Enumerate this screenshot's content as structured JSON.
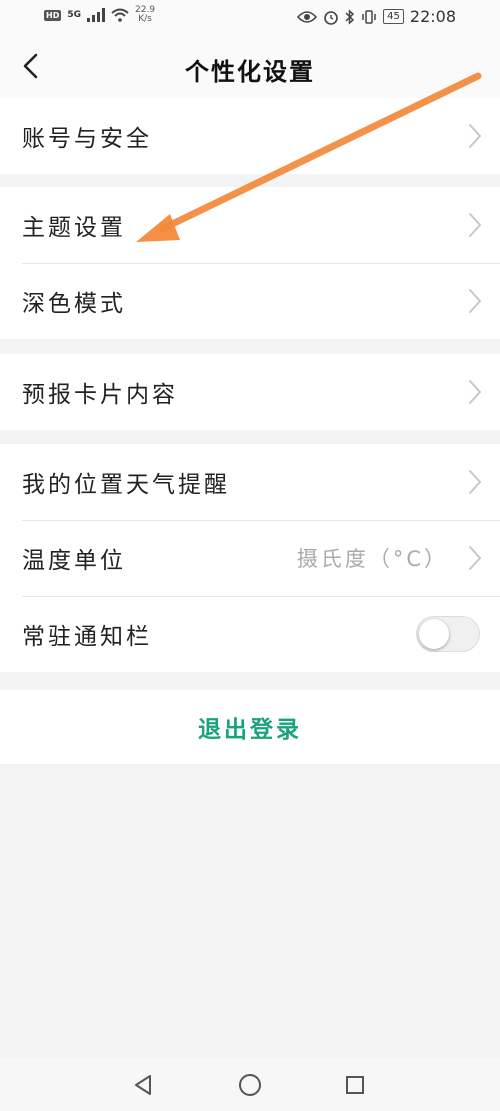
{
  "status_bar": {
    "hd": "HD",
    "network": "5G",
    "speed_value": "22.9",
    "speed_unit": "K/s",
    "battery": "45",
    "time": "22:08"
  },
  "header": {
    "title": "个性化设置",
    "back_icon": "chevron-left-icon"
  },
  "groups": {
    "account": {
      "label": "账号与安全"
    },
    "theme": {
      "label": "主题设置"
    },
    "dark_mode": {
      "label": "深色模式"
    },
    "forecast_card": {
      "label": "预报卡片内容"
    },
    "location_alert": {
      "label": "我的位置天气提醒"
    },
    "temp_unit": {
      "label": "温度单位",
      "value": "摄氏度（°C）"
    },
    "notification_bar": {
      "label": "常驻通知栏",
      "enabled": false
    }
  },
  "logout": {
    "label": "退出登录"
  },
  "colors": {
    "accent": "#1aa37a",
    "annotation_arrow": "#f28a3a",
    "background": "#f3f3f3"
  },
  "nav": {
    "back": "triangle-back-icon",
    "home": "circle-home-icon",
    "recents": "square-recents-icon"
  }
}
